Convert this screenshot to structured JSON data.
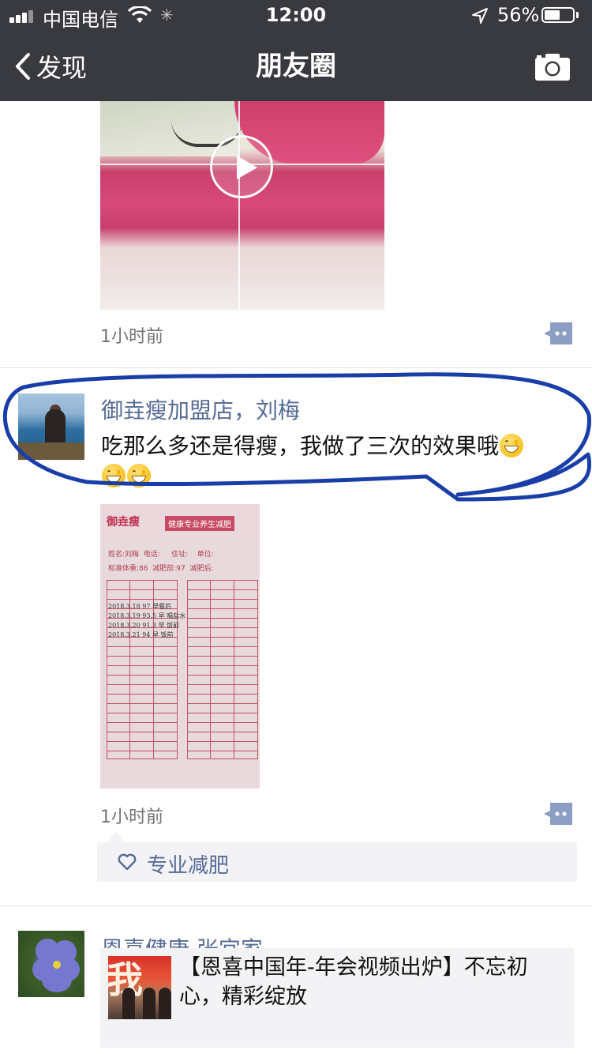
{
  "status_bar": {
    "carrier": "中国电信",
    "time": "12:00",
    "battery_percent": "56%",
    "battery_level": 0.56,
    "icons": [
      "signal-icon",
      "wifi-icon",
      "activity-spinner-icon",
      "location-arrow-icon",
      "battery-icon"
    ]
  },
  "nav": {
    "back_label": "发现",
    "title": "朋友圈",
    "camera_icon": "camera-icon"
  },
  "posts": [
    {
      "media": "video",
      "timestamp": "1小时前"
    },
    {
      "author": "御垚瘦加盟店，刘梅",
      "text": "吃那么多还是得瘦，我做了三次的效果哦",
      "emoji_line1": "grin-emoji",
      "emoji_line2": [
        "grin-emoji",
        "grin-emoji"
      ],
      "photo": {
        "brand": "御垚瘦",
        "slogan": "健康专业养生减肥",
        "field_name": "姓名:刘梅",
        "field_phone": "电话:",
        "field_address": "住址:",
        "field_unit": "单位:",
        "field_standard": "标准体重:86",
        "field_before": "减肥前:97",
        "field_after": "减肥后:",
        "ink_rows": [
          "2018.3.18  97  早餐后",
          "2018.3.19  93.5 早 喝盐水",
          "2018.3.20  91.3 早 饭前",
          "2018.3.21  94  早 饭前"
        ]
      },
      "timestamp": "1小时前",
      "likes": "专业减肥"
    },
    {
      "author": "恩喜健康   张宜家",
      "share": {
        "title": "【恩喜中国年-年会视频出炉】不忘初心，精彩绽放"
      }
    }
  ],
  "colors": {
    "nav_bg": "#393a3f",
    "link_blue": "#576b95",
    "annotation_blue": "#1a3ea8"
  }
}
